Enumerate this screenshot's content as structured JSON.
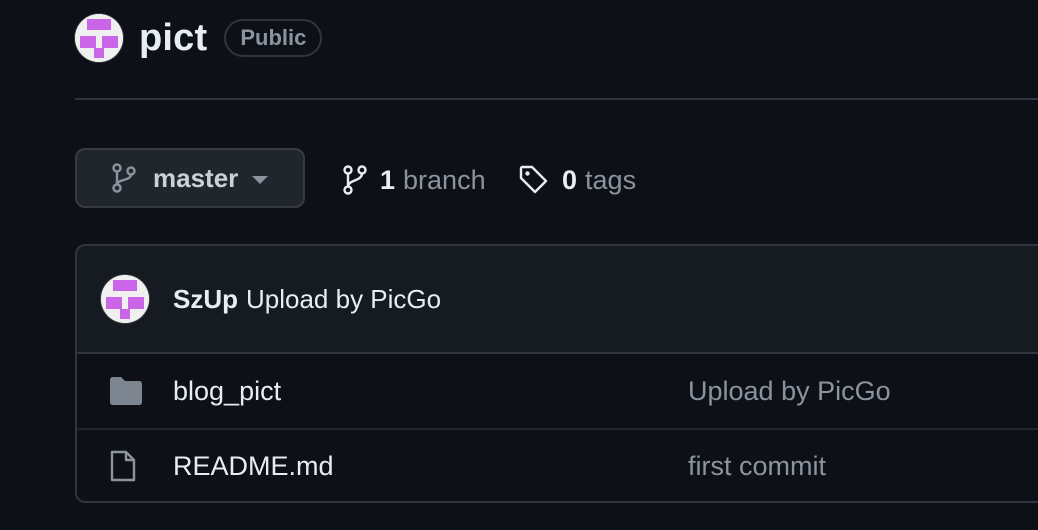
{
  "repo": {
    "owner_avatar_icon": "identicon-avatar",
    "name": "pict",
    "visibility": "Public"
  },
  "toolbar": {
    "branch_selector": {
      "icon": "git-branch-icon",
      "current_branch": "master"
    },
    "branches": {
      "icon": "git-branch-icon",
      "count": "1",
      "label": "branch"
    },
    "tags": {
      "icon": "tag-icon",
      "count": "0",
      "label": "tags"
    }
  },
  "latest_commit": {
    "avatar_icon": "identicon-avatar",
    "author": "SzUp",
    "message": "Upload by PicGo"
  },
  "files": [
    {
      "type": "directory",
      "icon": "folder-icon",
      "name": "blog_pict",
      "last_commit": "Upload by PicGo"
    },
    {
      "type": "file",
      "icon": "file-icon",
      "name": "README.md",
      "last_commit": "first commit"
    }
  ],
  "colors": {
    "background": "#0d1117",
    "border": "#30363d",
    "muted_text": "#8b949e",
    "identicon": "#c965e6"
  }
}
